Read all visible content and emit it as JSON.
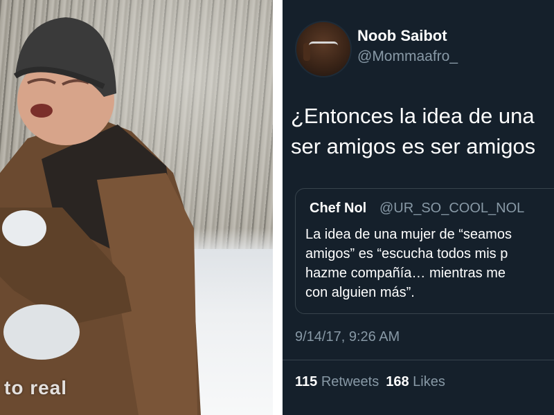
{
  "photo": {
    "watermark": "to real"
  },
  "tweet": {
    "author": {
      "display_name": "Noob Saibot",
      "handle": "@Mommaafro_"
    },
    "text_lines": [
      "¿Entonces la idea de una",
      "ser amigos es ser amigos"
    ],
    "quoted": {
      "display_name": "Chef Nol",
      "handle": "@UR_SO_COOL_NOL",
      "text_lines": [
        "La idea de una mujer de “seamos",
        "amigos” es “escucha todos mis p",
        "hazme compañía… mientras me",
        "con alguien más”."
      ]
    },
    "timestamp": "9/14/17, 9:26 AM",
    "retweets_count": "115",
    "retweets_label": "Retweets",
    "likes_count": "168",
    "likes_label": "Likes"
  },
  "colors": {
    "tweet_background": "#15202b",
    "secondary_text": "#8899a6",
    "border": "#38444d"
  }
}
